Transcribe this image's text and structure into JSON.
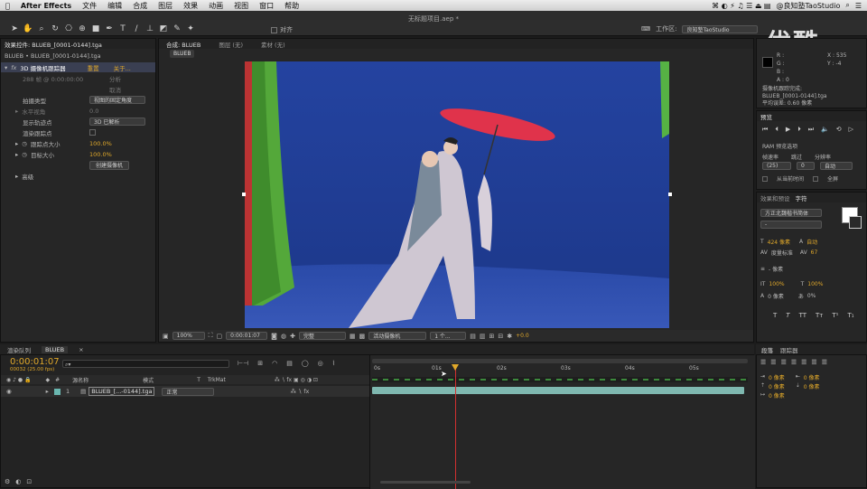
{
  "menubar": {
    "apple": "",
    "app": "After Effects",
    "items": [
      "文件",
      "编辑",
      "合成",
      "图层",
      "效果",
      "动画",
      "视图",
      "窗口",
      "帮助"
    ],
    "right": "@良知塾TaoStudio"
  },
  "toolbar": {
    "title": "无标题项目.aep *",
    "workspace_label": "工作区:",
    "workspace_value": "良知塾TaoStudio",
    "align_label": "对齐"
  },
  "watermark": "优酷",
  "effects": {
    "tab": "效果控件: BLUEB_[0001-0144].tga",
    "breadcrumb": "BLUEB • BLUEB_[0001-0144].tga",
    "fx_name": "3D 摄像机跟踪器",
    "reset": "重置",
    "about": "关于...",
    "status": "288 帧 @ 0:00:00:00",
    "analyze": "分析",
    "cancel": "取消",
    "shoot_type_label": "拍摄类型",
    "shoot_type_value": "视图的固定角度",
    "hfov_label": "水平视角",
    "hfov_value": "0.0",
    "show_points_label": "显示轨迹点",
    "show_points_value": "3D 已解析",
    "render_points_label": "渲染跟踪点",
    "point_size_label": "跟踪点大小",
    "point_size_value": "100.0%",
    "target_size_label": "目标大小",
    "target_size_value": "100.0%",
    "create_camera": "创建摄像机",
    "advanced": "高级"
  },
  "comp": {
    "tab_comp": "合成: BLUEB",
    "tab_layer": "图层 (无)",
    "tab_footage": "素材 (无)",
    "flow": "BLUEB",
    "zoom": "100%",
    "time": "0:00:01:07",
    "quality": "完整",
    "camera": "活动摄像机",
    "views": "1 个...",
    "exposure": "+0.0"
  },
  "info": {
    "r": "R :",
    "g": "G :",
    "b": "B :",
    "a": "A : 0",
    "x": "X : 535",
    "y": "Y : -4",
    "msg1": "摄像机跟踪完成:",
    "msg2": "BLUEB_[0001-0144].tga",
    "msg3": "平均误差: 0.60 像素"
  },
  "preview": {
    "tab": "预览",
    "ram": "RAM 预览选项",
    "fps_label": "帧速率",
    "skip_label": "跳过",
    "res_label": "分辨率",
    "fps": "(25)",
    "skip": "0",
    "res": "自动",
    "from_current": "从当前时间",
    "fullscreen": "全屏"
  },
  "character": {
    "tab1": "效果和预设",
    "tab2": "字符",
    "font": "方正北魏楷书简体",
    "style": "-",
    "size": "424 像素",
    "leading": "自动",
    "kern": "度量标准",
    "track": "67",
    "stroke": "- 像素",
    "vscale": "100%",
    "hscale": "100%",
    "baseline": "0 像素",
    "tsume": "0%"
  },
  "paragraph": {
    "tab1": "段落",
    "tab2": "跟踪器",
    "indent1": "0 像素",
    "indent2": "0 像素",
    "indent3": "0 像素",
    "space1": "0 像素",
    "space2": "0 像素"
  },
  "render_queue": "渲染队列",
  "timeline": {
    "tab": "BLUEB",
    "timecode": "0:00:01:07",
    "frames": "00032 (25.00 fps)",
    "search_ph": "",
    "cols": {
      "num": "#",
      "name": "源名称",
      "mode": "模式",
      "t": "T",
      "trkmat": "TrkMat"
    },
    "layer": {
      "num": "1",
      "name": "BLUEB_[...-0144].tga",
      "mode": "正常"
    },
    "ruler": [
      "0s",
      "01s",
      "02s",
      "03s",
      "04s",
      "05s"
    ]
  }
}
